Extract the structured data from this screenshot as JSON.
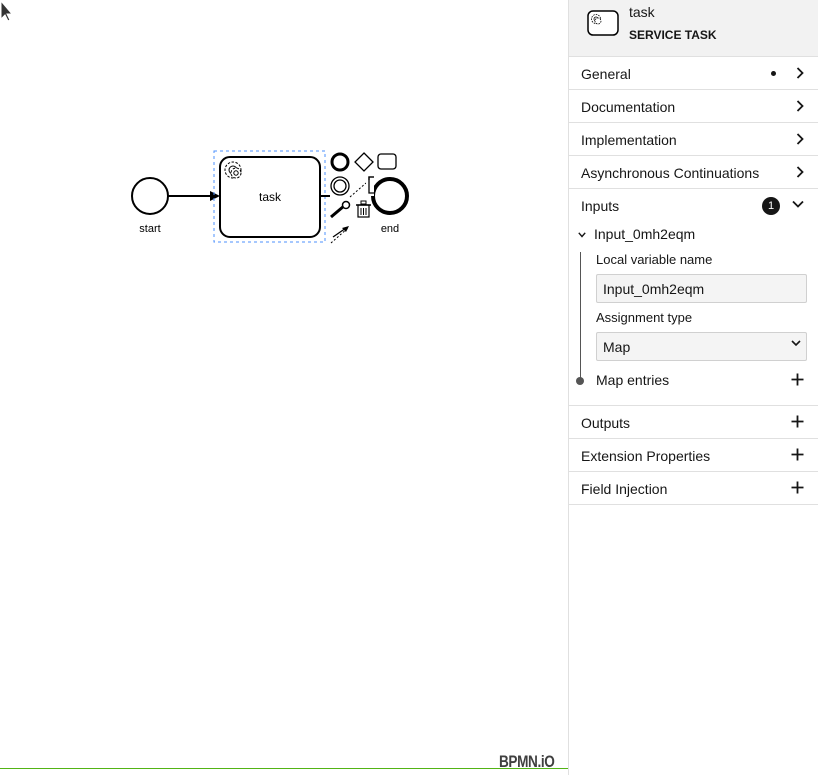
{
  "canvas": {
    "start_label": "start",
    "task_label": "task",
    "end_label": "end",
    "watermark": "BPMN.iO"
  },
  "header": {
    "element_name": "task",
    "element_type": "SERVICE TASK"
  },
  "groups": {
    "general": "General",
    "documentation": "Documentation",
    "implementation": "Implementation",
    "async": "Asynchronous Continuations",
    "inputs": "Inputs",
    "inputs_count": "1",
    "outputs": "Outputs",
    "extension_properties": "Extension Properties",
    "field_injection": "Field Injection"
  },
  "input_item": {
    "name": "Input_0mh2eqm",
    "local_variable_label": "Local variable name",
    "local_variable_value": "Input_0mh2eqm",
    "assignment_type_label": "Assignment type",
    "assignment_type_value": "Map",
    "map_entries_label": "Map entries"
  },
  "colors": {
    "accent": "#52b415",
    "selection": "#4d90fe",
    "panel_header": "#f2f2f2"
  }
}
